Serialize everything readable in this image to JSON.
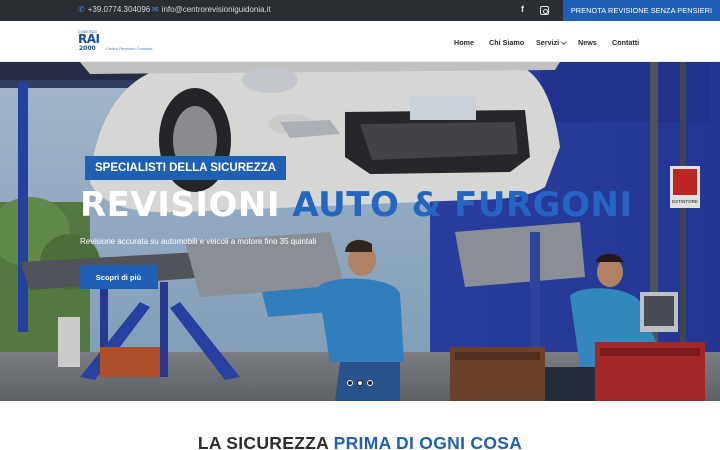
{
  "topbar": {
    "phone": "+39.0774.304096",
    "email": "info@centrorevisioniguidonia.it",
    "social_facebook": "f",
    "cta": "PRENOTA REVISIONE SENZA PENSIERI"
  },
  "logo": {
    "consorzio": "CONSORZIO",
    "name": "RAI",
    "year": "2000",
    "tagline": "Centro Revisioni Guidonia"
  },
  "nav": {
    "home": "Home",
    "chi_siamo": "Chi Siamo",
    "servizi": "Servizi",
    "news": "News",
    "contatti": "Contatti"
  },
  "hero": {
    "badge": "SPECIALISTI DELLA SICUREZZA",
    "title_main": "REVISIONI",
    "title_accent": "AUTO & FURGONI",
    "subtitle": "Revisione accurata su automobili e veicoli a motore fino 35 quintali",
    "button": "Scopri di più",
    "extinguisher_label": "ESTINTORE",
    "slides_total": 3,
    "slide_active": 2
  },
  "section": {
    "title_main": "LA SICUREZZA",
    "title_accent": "PRIMA DI OGNI COSA"
  },
  "colors": {
    "topbar_bg": "#2a2d32",
    "brand_blue": "#1f5fb4",
    "accent_blue": "#2466c2",
    "garage_blue": "#2f49b8"
  },
  "icons": {
    "phone": "phone-icon",
    "email": "envelope-icon",
    "facebook": "facebook-icon",
    "instagram": "instagram-icon",
    "dropdown": "chevron-down-icon"
  }
}
